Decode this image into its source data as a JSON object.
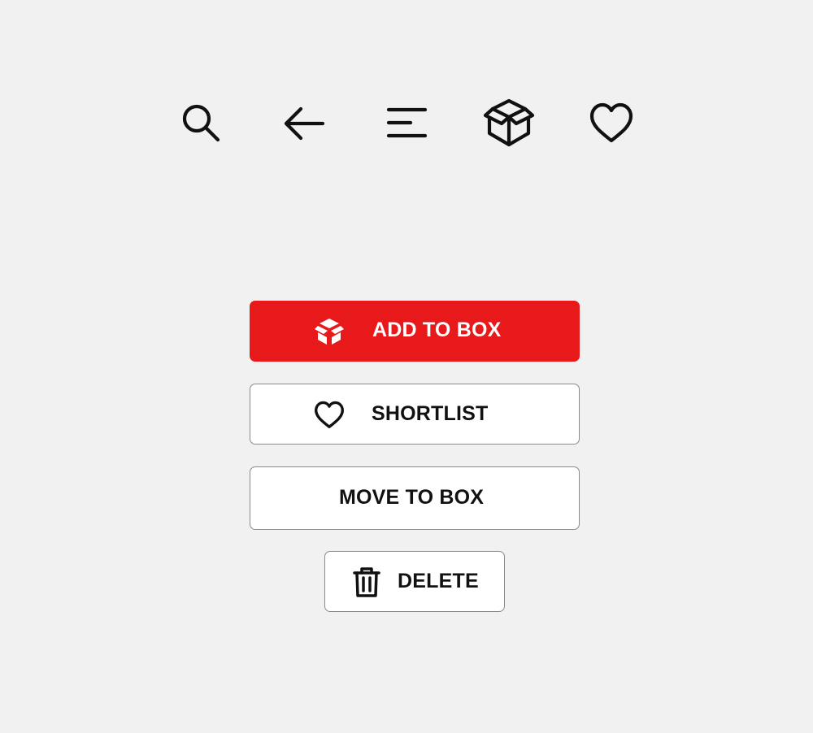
{
  "icon_row": [
    {
      "icon": "search-icon"
    },
    {
      "icon": "arrow-left-icon"
    },
    {
      "icon": "menu-icon"
    },
    {
      "icon": "box-icon"
    },
    {
      "icon": "heart-icon"
    }
  ],
  "buttons": {
    "add_to_box": {
      "label": "ADD TO BOX",
      "icon": "box-icon"
    },
    "shortlist": {
      "label": "SHORTLIST",
      "icon": "heart-icon"
    },
    "move_to_box": {
      "label": "MOVE TO BOX"
    },
    "delete": {
      "label": "DELETE",
      "icon": "trash-icon"
    }
  },
  "colors": {
    "background": "#f1f1f1",
    "primary": "#e8191b",
    "outline_border": "#8a8a8a",
    "text_dark": "#111111"
  }
}
